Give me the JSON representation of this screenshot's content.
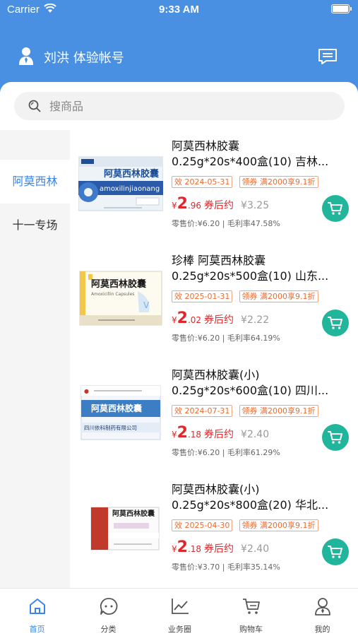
{
  "status_bar": {
    "carrier": "Carrier",
    "time": "9:33 AM"
  },
  "header": {
    "user_name": "刘洪 体验帐号"
  },
  "search": {
    "placeholder": "搜商品"
  },
  "categories": [
    {
      "label": "阿莫西林",
      "active": true
    },
    {
      "label": "十一专场",
      "active": false
    }
  ],
  "products": [
    {
      "name_line1": "阿莫西林胶囊",
      "name_line2": "0.25g*20s*400盒(10) 吉林...",
      "expiry": "效 2024-05-31",
      "coupon": "领券 满2000享9.1折",
      "yen": "¥",
      "price_int": "2",
      "price_dec": ".96",
      "after_coupon": "券后约",
      "orig_price": "¥3.25",
      "retail": "零售价:¥6.20 | 毛利率47.58%"
    },
    {
      "name_line1": "珍棒 阿莫西林胶囊",
      "name_line2": "0.25g*20s*500盒(10) 山东...",
      "expiry": "效 2025-01-31",
      "coupon": "领券 满2000享9.1折",
      "yen": "¥",
      "price_int": "2",
      "price_dec": ".02",
      "after_coupon": "券后约",
      "orig_price": "¥2.22",
      "retail": "零售价:¥6.20 | 毛利率64.19%"
    },
    {
      "name_line1": "阿莫西林胶囊(小)",
      "name_line2": "0.25g*20s*600盒(10) 四川...",
      "expiry": "效 2024-07-31",
      "coupon": "领券 满2000享9.1折",
      "yen": "¥",
      "price_int": "2",
      "price_dec": ".18",
      "after_coupon": "券后约",
      "orig_price": "¥2.40",
      "retail": "零售价:¥6.20 | 毛利率61.29%"
    },
    {
      "name_line1": "阿莫西林胶囊(小)",
      "name_line2": "0.25g*20s*800盒(20) 华北...",
      "expiry": "效 2025-04-30",
      "coupon": "领券 满2000享9.1折",
      "yen": "¥",
      "price_int": "2",
      "price_dec": ".18",
      "after_coupon": "券后约",
      "orig_price": "¥2.40",
      "retail": "零售价:¥3.70 | 毛利率35.14%"
    }
  ],
  "product_images": [
    {
      "box_title": "阿莫西林胶囊",
      "box_subtitle": "amoxilinjiaonang",
      "brand_color": "#2b5aa8"
    },
    {
      "box_title": "阿莫西林胶囊",
      "box_subtitle": "Amoxicillin Capsules",
      "brand_color": "#2d6fb8"
    },
    {
      "box_title": "阿莫西林胶囊",
      "box_subtitle": "四川依科制药有限公司",
      "brand_color": "#3b7ec4"
    },
    {
      "box_title": "阿莫西林胶囊",
      "box_subtitle": "",
      "brand_color": "#c0392b"
    }
  ],
  "tabs": [
    {
      "label": "首页",
      "icon": "home-icon",
      "active": true
    },
    {
      "label": "分类",
      "icon": "category-icon",
      "active": false
    },
    {
      "label": "业务圈",
      "icon": "chart-icon",
      "active": false
    },
    {
      "label": "购物车",
      "icon": "cart-icon",
      "active": false
    },
    {
      "label": "我的",
      "icon": "profile-icon",
      "active": false
    }
  ],
  "colors": {
    "primary": "#4a90e2",
    "accent_blue": "#3a86e8",
    "price_red": "#e0272b",
    "tag_orange": "#ee6a2c",
    "cart_green": "#21b69b"
  }
}
